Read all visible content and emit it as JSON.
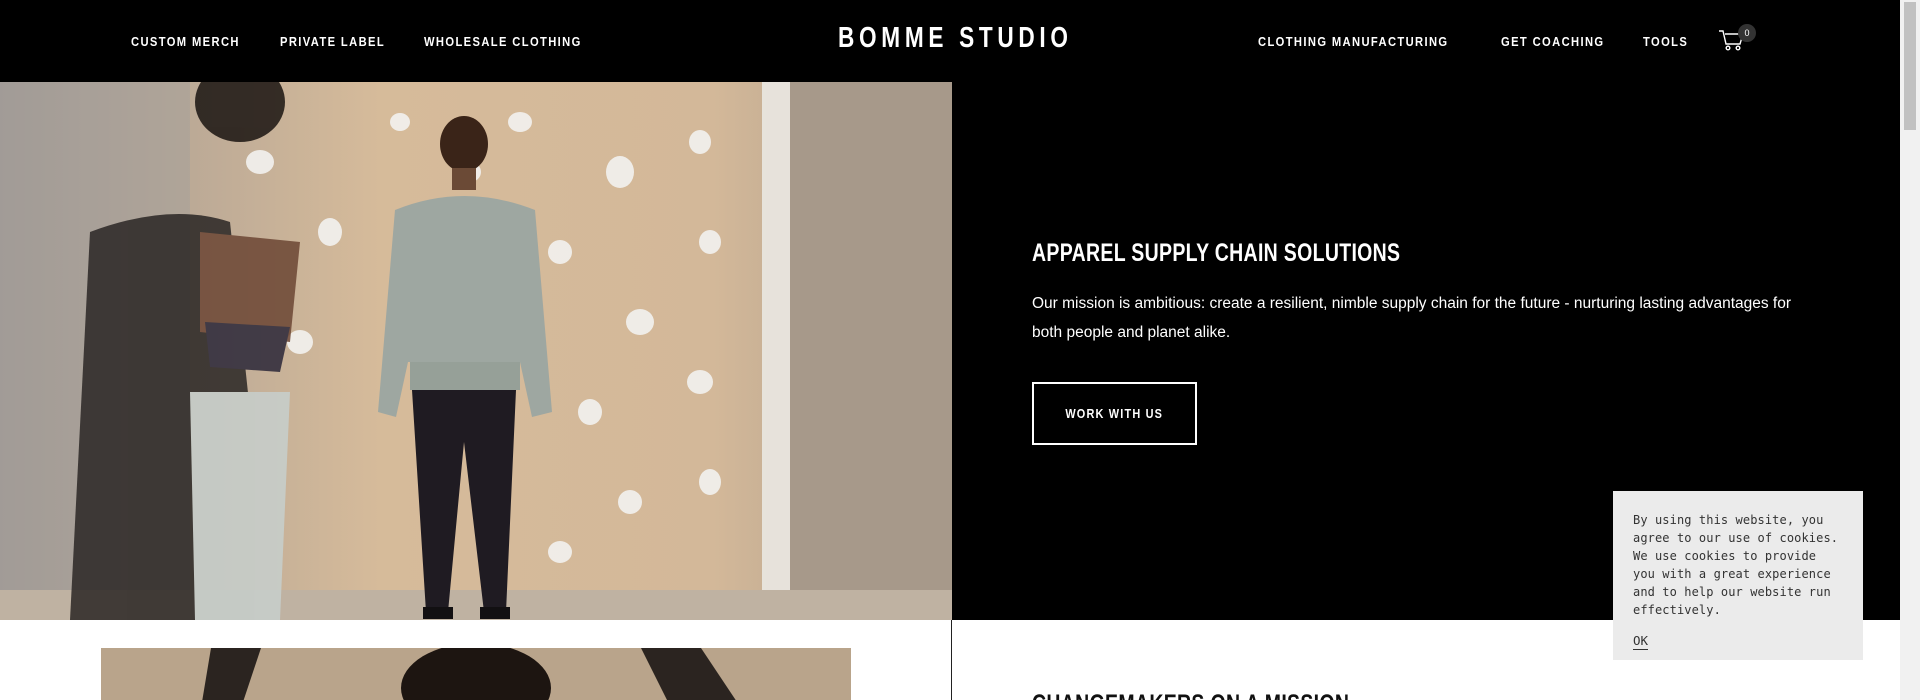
{
  "header": {
    "logo": "BOMME STUDIO",
    "nav_left": [
      "CUSTOM MERCH",
      "PRIVATE LABEL",
      "WHOLESALE CLOTHING"
    ],
    "nav_right": [
      "CLOTHING MANUFACTURING",
      "GET COACHING",
      "TOOLS"
    ],
    "cart_count": "0",
    "cart_icon": "cart-icon"
  },
  "hero": {
    "title": "APPAREL SUPPLY CHAIN SOLUTIONS",
    "text": "Our mission is ambitious: create a resilient, nimble supply chain for the future - nurturing lasting advantages for both people and planet alike.",
    "button_label": "WORK WITH US"
  },
  "section2": {
    "title": "CHANGEMAKERS ON A MISSION"
  },
  "cookie": {
    "text": "By using this website, you agree to our use of cookies. We use cookies to provide you with a great experience and to help our website run effectively.",
    "ok_label": "OK"
  },
  "colors": {
    "header_bg": "#000000",
    "panel_bg": "#000000",
    "cookie_bg": "#ebebeb"
  }
}
